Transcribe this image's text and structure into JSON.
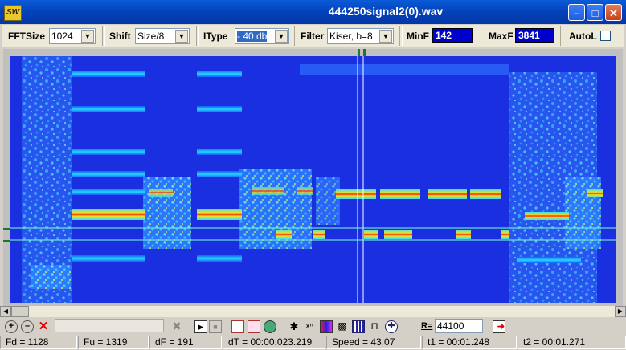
{
  "window": {
    "title": "444250signal2(0).wav",
    "app_icon_text": "SW"
  },
  "toolbar": {
    "fftsize": {
      "label": "FFTSize",
      "value": "1024"
    },
    "shift": {
      "label": "Shift",
      "value": "Size/8"
    },
    "itype": {
      "label": "IType",
      "value": "- 40 db"
    },
    "filter": {
      "label": "Filter",
      "value": "Kiser, b=8"
    },
    "minf": {
      "label": "MinF",
      "value": "142"
    },
    "maxf": {
      "label": "MaxF",
      "value": "3841"
    },
    "autol": {
      "label": "AutoL",
      "checked": false
    }
  },
  "bottom": {
    "rate_prefix": "R=",
    "rate_value": "44100"
  },
  "status": {
    "fd": "Fd = 1128",
    "fu": "Fu = 1319",
    "df": "dF = 191",
    "dt": "dT = 00:00.023.219",
    "speed": "Speed = 43.07",
    "t1": "t1 = 00:01.248",
    "t2": "t2 = 00:01.271"
  },
  "colors": {
    "title_bar": "#0a5bd8",
    "spectrogram_bg": "#1a2fe0",
    "marker_line": "#7fffd4",
    "value_box": "#0000cc"
  }
}
